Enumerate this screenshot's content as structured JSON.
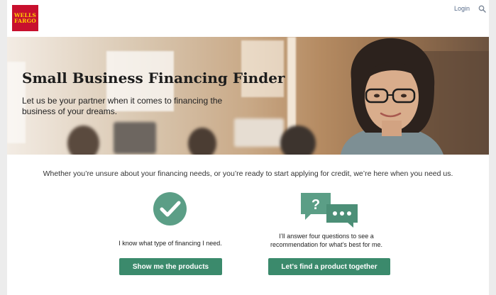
{
  "header": {
    "logo_line1": "WELLS",
    "logo_line2": "FARGO",
    "login_label": "Login",
    "search_icon": "magnifier-icon"
  },
  "hero": {
    "title": "Small Business Financing Finder",
    "subtitle": "Let us be your partner when it comes to financing the business of your dreams."
  },
  "main": {
    "intro": "Whether you’re unsure about your financing needs, or you’re ready to start applying for credit, we’re here when you need us.",
    "option_left": {
      "icon": "checkmark-circle-icon",
      "caption": "I know what type of financing I need.",
      "button_label": "Show me the products"
    },
    "option_right": {
      "icon": "chat-bubbles-icon",
      "question_mark": "?",
      "caption": "I’ll answer four questions to see a recommendation for what’s best for me.",
      "button_label": "Let’s find a product together"
    }
  },
  "colors": {
    "brand_red": "#c8102e",
    "brand_gold": "#ffd200",
    "accent_green": "#3b8a6c",
    "icon_green": "#5b9e86"
  }
}
